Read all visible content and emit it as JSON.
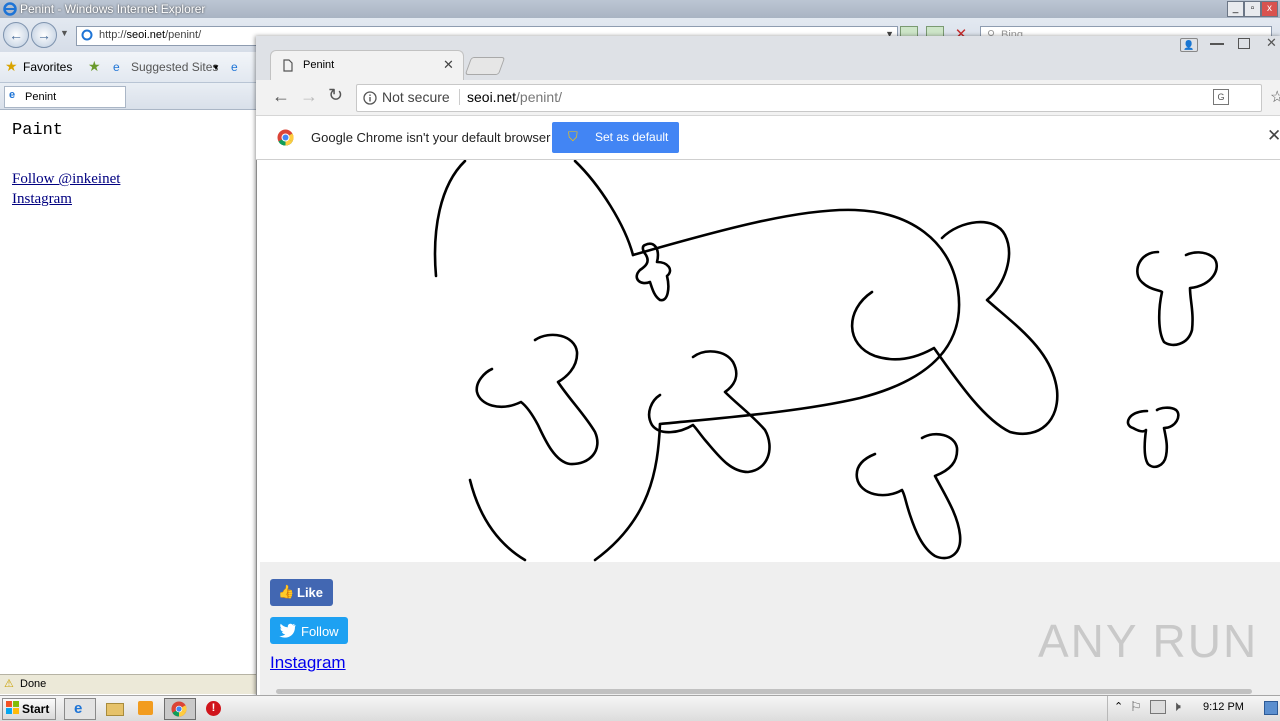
{
  "ie": {
    "title": "Penint - Windows Internet Explorer",
    "url_prefix": "http://",
    "url_host": "seoi.net",
    "url_path": "/penint/",
    "search_placeholder": "Bing",
    "favorites_label": "Favorites",
    "suggested_sites_label": "Suggested Sites",
    "tab_label": "Penint",
    "page": {
      "title": "Paint",
      "follow_link": "Follow @inkeinet",
      "instagram_link": "Instagram"
    },
    "status": "Done"
  },
  "chrome": {
    "tab_title": "Penint",
    "security_label": "Not secure",
    "url_host": "seoi.net",
    "url_path": "/penint/",
    "infobar_message": "Google Chrome isn't your default browser",
    "set_default_label": "Set as default",
    "like_label": "Like",
    "follow_label": "Follow",
    "instagram_label": "Instagram",
    "watermark": "ANY RUN"
  },
  "taskbar": {
    "start_label": "Start",
    "time": "9:12 PM"
  },
  "colors": {
    "facebook_blue": "#4267b2",
    "twitter_blue": "#1da1f2",
    "chrome_accent": "#4285f4",
    "link_blue": "#0000ee",
    "drawing_stroke": "#000000"
  }
}
